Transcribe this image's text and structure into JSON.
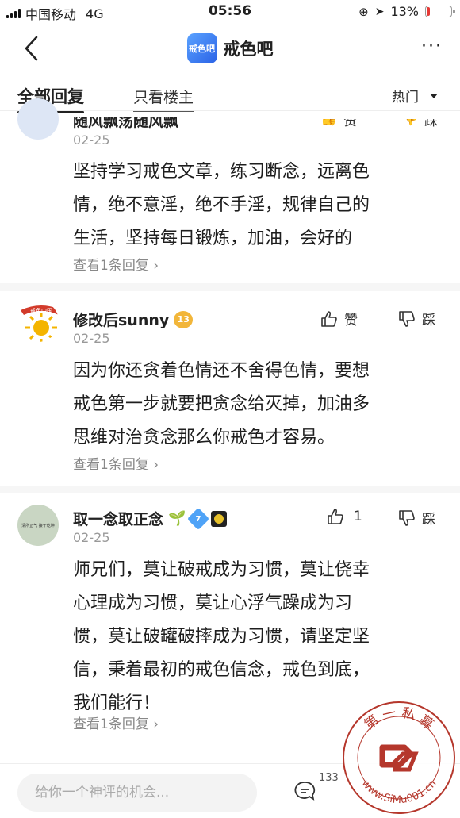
{
  "status": {
    "carrier": "中国移动",
    "network": "4G",
    "time": "05:56",
    "battery": "13%",
    "battery_level": 0.13
  },
  "nav": {
    "logo_text": "戒色吧",
    "title": "戒色吧",
    "more": "···"
  },
  "tabs": {
    "all": "全部回复",
    "op_only": "只看楼主",
    "sort": "热门"
  },
  "comments": [
    {
      "username": "随风飘荡随风飘",
      "date": "02-25",
      "lines": [
        "坚持学习戒色文章，练习断念，远离色",
        "情，绝不意淫，绝不手淫，规律自己的",
        "生活，坚持每日锻炼，加油，会好的"
      ],
      "replies": "查看1条回复",
      "like_label": "赞",
      "dislike_label": "踩"
    },
    {
      "username": "修改后sunny",
      "level": "13",
      "avatar_text": "戒色中国",
      "date": "02-25",
      "lines": [
        "因为你还贪着色情还不舍得色情，要想",
        "戒色第一步就要把贪念给灭掉，加油多",
        "思维对治贪念那么你戒色才容易。"
      ],
      "replies": "查看1条回复",
      "like_label": "赞",
      "dislike_label": "踩"
    },
    {
      "username": "取一念取正念",
      "level": "7",
      "avatar_text": "清所正气 接干乾坤",
      "date": "02-25",
      "lines": [
        "师兄们，莫让破戒成为习惯，莫让侥幸",
        "心理成为习惯，莫让心浮气躁成为习",
        "惯，莫让破罐破摔成为习惯，请坚定坚",
        "信，秉着最初的戒色信念，戒色到底，",
        "我们能行！"
      ],
      "replies": "查看1条回复",
      "like_count": "1",
      "dislike_label": "踩"
    }
  ],
  "bottom": {
    "placeholder": "给你一个神评的机会...",
    "comment_count": "133"
  },
  "watermark": {
    "top_text": "第 一 私 募",
    "bottom_text": "www.SiMu001.cn"
  }
}
